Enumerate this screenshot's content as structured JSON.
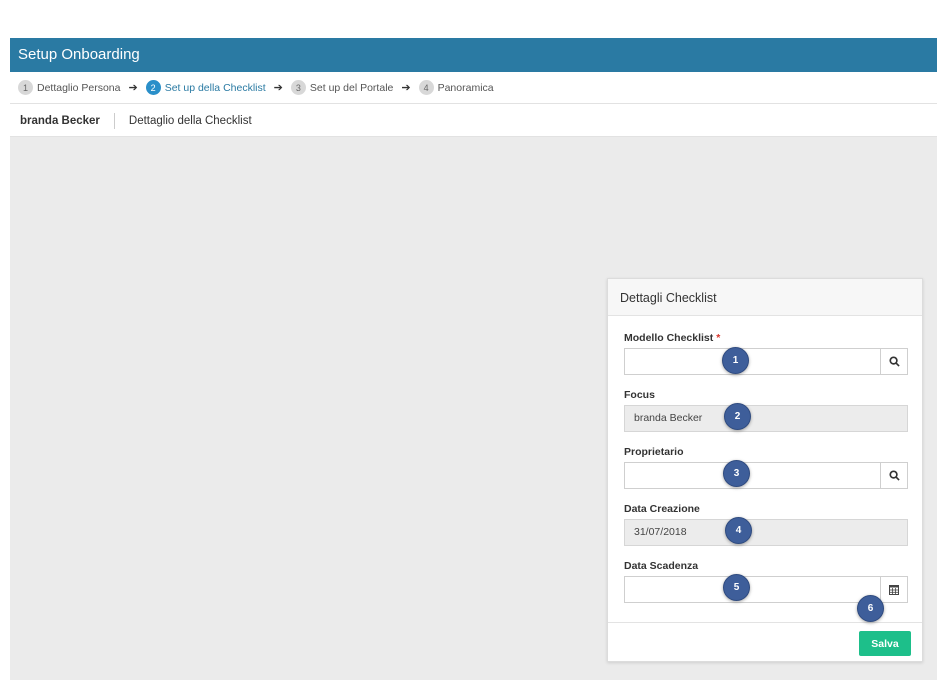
{
  "header": {
    "title": "Setup Onboarding"
  },
  "steps": [
    {
      "num": "1",
      "label": "Dettaglio Persona"
    },
    {
      "num": "2",
      "label": "Set up della Checklist"
    },
    {
      "num": "3",
      "label": "Set up del Portale"
    },
    {
      "num": "4",
      "label": "Panoramica"
    }
  ],
  "breadcrumb": {
    "person": "branda Becker",
    "page": "Dettaglio della Checklist"
  },
  "panel": {
    "title": "Dettagli Checklist",
    "fields": {
      "modello": {
        "label": "Modello Checklist",
        "required_mark": "*",
        "value": ""
      },
      "focus": {
        "label": "Focus",
        "value": "branda Becker"
      },
      "proprietario": {
        "label": "Proprietario",
        "value": ""
      },
      "data_creazione": {
        "label": "Data Creazione",
        "value": "31/07/2018"
      },
      "data_scadenza": {
        "label": "Data Scadenza",
        "value": ""
      }
    },
    "save_label": "Salva"
  },
  "badges": [
    "1",
    "2",
    "3",
    "4",
    "5",
    "6"
  ],
  "icons": {
    "lookup": "search-icon",
    "date": "calendar-icon"
  },
  "colors": {
    "header": "#2a7aa3",
    "active_step": "#2a8fc9",
    "save": "#1dbf8a",
    "badge": "#3e5e9a",
    "required": "#d9342b"
  }
}
